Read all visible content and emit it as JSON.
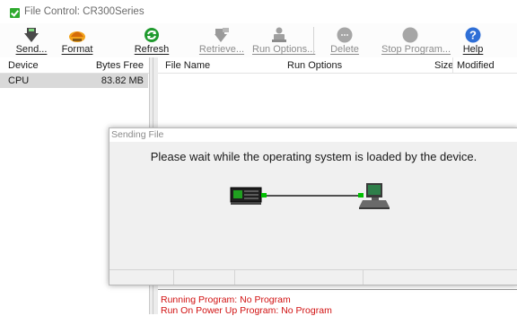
{
  "window": {
    "title": "File Control: CR300Series"
  },
  "toolbar": {
    "buttons": [
      {
        "label": "Send...",
        "icon": "send-icon",
        "enabled": true
      },
      {
        "label": "Format",
        "icon": "format-icon",
        "enabled": true
      },
      {
        "label": "Refresh",
        "icon": "refresh-icon",
        "enabled": true
      },
      {
        "label": "Retrieve...",
        "icon": "retrieve-icon",
        "enabled": false
      },
      {
        "label": "Run Options...",
        "icon": "run-options-icon",
        "enabled": false
      },
      {
        "label": "Delete",
        "icon": "delete-icon",
        "enabled": false
      },
      {
        "label": "Stop Program...",
        "icon": "stop-program-icon",
        "enabled": false
      },
      {
        "label": "Help",
        "icon": "help-icon",
        "enabled": true
      }
    ]
  },
  "device_panel": {
    "columns": [
      "Device",
      "Bytes Free"
    ],
    "rows": [
      {
        "device": "CPU",
        "bytes_free": "83.82 MB"
      }
    ]
  },
  "file_list": {
    "columns": [
      "File Name",
      "Run Options",
      "Size",
      "Modified"
    ]
  },
  "status": {
    "running_program": "Running Program: No Program",
    "run_on_power_up": "Run On Power Up Program: No Program"
  },
  "dialog": {
    "title": "Sending File",
    "message": "Please wait while the operating system is loaded by the device."
  },
  "colors": {
    "status_text": "#d11212",
    "selected_row": "#d9d9d9",
    "link_green": "#00c000",
    "device_screen": "#20a020"
  }
}
